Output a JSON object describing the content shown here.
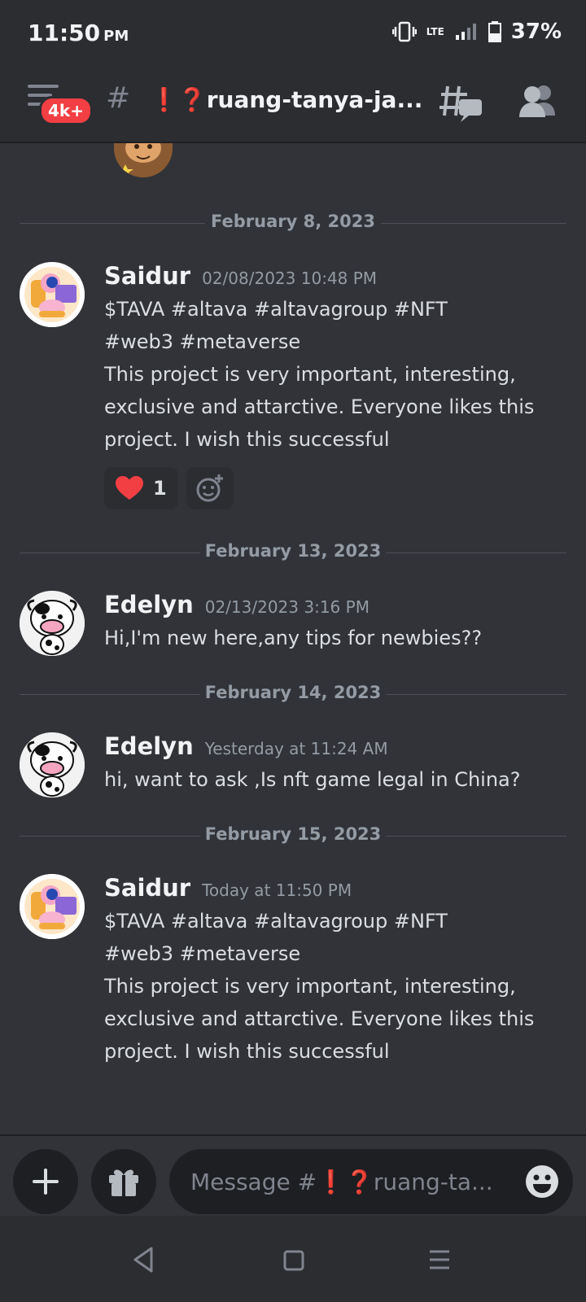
{
  "status_bar": {
    "time": "11:50",
    "ampm": "PM",
    "battery_percent": "37%",
    "network": "LTE"
  },
  "header": {
    "badge": "4k+",
    "hash": "#",
    "channel_name_emoji": "❗❓",
    "channel_name": "ruang-tanya-ja..."
  },
  "dividers": [
    {
      "label": "February 8, 2023"
    },
    {
      "label": "February 13, 2023"
    },
    {
      "label": "February 14, 2023"
    },
    {
      "label": "February 15, 2023"
    }
  ],
  "messages": [
    {
      "author": "Saidur",
      "timestamp": "02/08/2023 10:48 PM",
      "text": "$TAVA #altava #altavagroup #NFT\n#web3 #metaverse\nThis project is very important, interesting,\nexclusive and attarctive. Everyone likes this\nproject. I wish this successful",
      "reaction_count": "1"
    },
    {
      "author": "Edelyn",
      "timestamp": "02/13/2023 3:16 PM",
      "text": "Hi,I'm new here,any tips for newbies??"
    },
    {
      "author": "Edelyn",
      "timestamp": "Yesterday at 11:24 AM",
      "text": "hi, want to ask ,Is nft game legal in China?"
    },
    {
      "author": "Saidur",
      "timestamp": "Today at 11:50 PM",
      "text": "$TAVA #altava #altavagroup #NFT\n#web3 #metaverse\nThis project is very important, interesting,\nexclusive and attarctive. Everyone likes this\nproject. I wish this successful"
    }
  ],
  "composer": {
    "placeholder_prefix": "Message #",
    "placeholder_emoji": "❗❓",
    "placeholder_name": "ruang-ta..."
  },
  "colors": {
    "background": "#313338",
    "bar": "#2b2d31",
    "badge_red": "#f23f43",
    "heart_red": "#f23f43"
  }
}
